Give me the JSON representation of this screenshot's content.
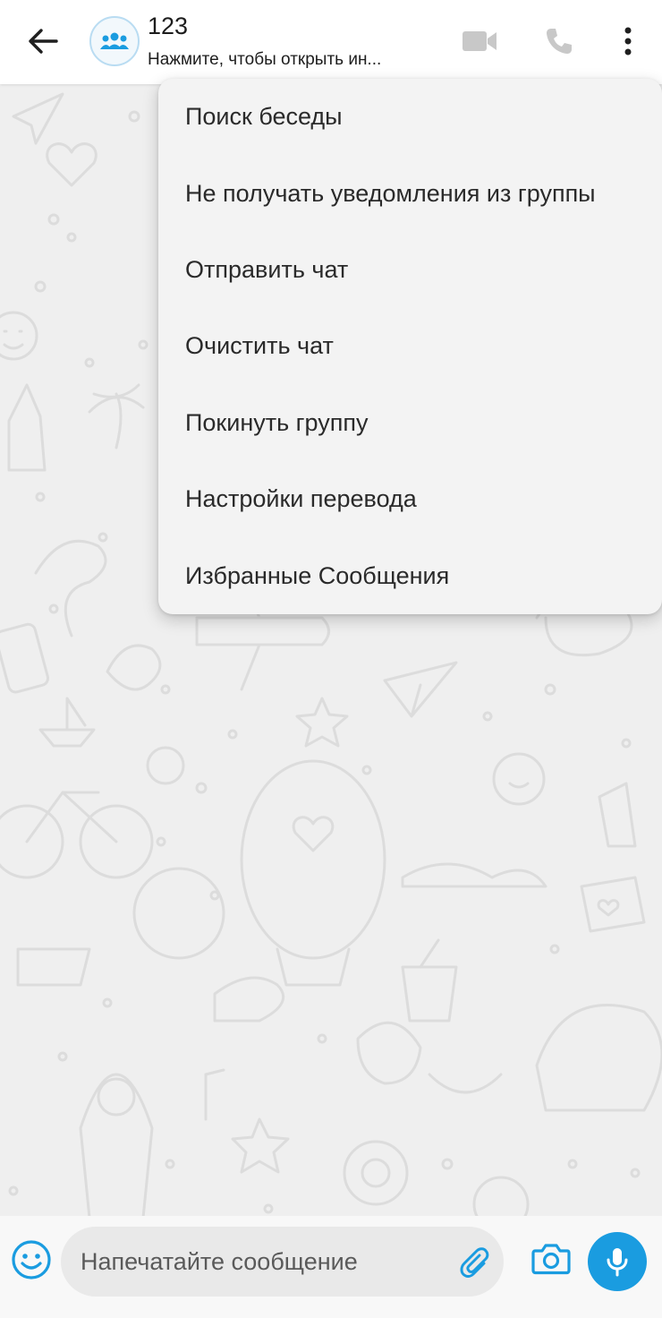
{
  "header": {
    "title": "123",
    "subtitle": "Нажмите, чтобы открыть ин..."
  },
  "menu": {
    "items": [
      "Поиск беседы",
      "Не получать уведомления из группы",
      "Отправить чат",
      "Очистить чат",
      "Покинуть группу",
      "Настройки перевода",
      "Избранные Сообщения"
    ]
  },
  "composer": {
    "placeholder": "Напечатайте сообщение"
  },
  "colors": {
    "accent": "#1a9ce0",
    "header_bg": "#ffffff",
    "wallpaper_bg": "#efefef",
    "menu_bg": "#f3f3f3"
  },
  "icons": {
    "back": "arrow-left-icon",
    "avatar": "group-icon",
    "video": "video-camera-icon",
    "call": "phone-icon",
    "more": "more-vertical-icon",
    "emoji": "smiley-icon",
    "attach": "paperclip-icon",
    "camera": "camera-icon",
    "mic": "microphone-icon"
  }
}
